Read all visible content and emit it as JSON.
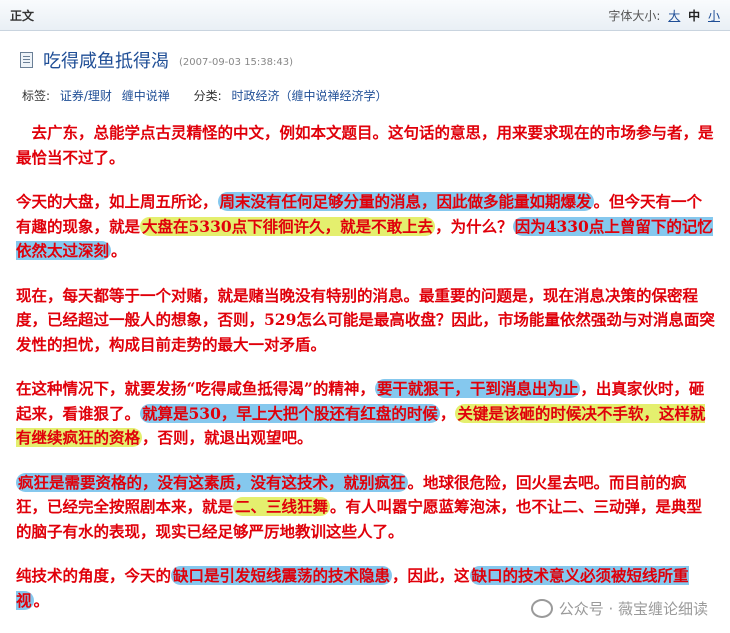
{
  "topbar": {
    "section_label": "正文",
    "fontsize_label": "字体大小:",
    "opts": [
      "大",
      "中",
      "小"
    ]
  },
  "post": {
    "title": "吃得咸鱼抵得渴",
    "date": "(2007-09-03 15:38:43)",
    "tags_label": "标签:",
    "tags": [
      "证券/理财",
      "缠中说禅"
    ],
    "category_label": "分类:",
    "category": "时政经济（缠中说禅经济学）"
  },
  "article": {
    "p1": "　去广东，总能学点古灵精怪的中文，例如本文题目。这句话的意思，用来要求现在的市场参与者，是最恰当不过了。",
    "p2": [
      "今天的大盘，如上周五所论，",
      "周末没有任何足够分量的消息，因此做多能量如期爆发",
      "。但今天有一个有趣的现象，就是",
      "大盘在5330点下徘徊许久，就是不敢上去",
      "，为什么？",
      "因为4330点上曾留下的记忆依然太过深刻",
      "。"
    ],
    "p3": "现在，每天都等于一个对赌，就是赌当晚没有特别的消息。最重要的问题是，现在消息决策的保密程度，已经超过一般人的想象，否则，529怎么可能是最高收盘？因此，市场能量依然强劲与对消息面突发性的担忧，构成目前走势的最大一对矛盾。",
    "p4": [
      "在这种情况下，就要发扬“吃得咸鱼抵得渴”的精神，",
      "要干就狠干，干到消息出为止",
      "，出真家伙时，砸起来，看谁狠了。",
      "就算是530，早上大把个股还有红盘的时候",
      "，",
      "关键是该砸的时候决不手软，这样就有继续疯狂的资格",
      "，否则，就退出观望吧。"
    ],
    "p5": [
      "疯狂是需要资格的，没有这素质，没有这技术，就别疯狂",
      "。地球很危险，回火星去吧。而目前的疯狂，已经完全按照剧本来，就是",
      "二、三线狂舞",
      "。有人叫嚣宁愿蓝筹泡沫，也不让二、三动弹，是典型的脑子有水的表现，现实已经足够严厉地教训这些人了。"
    ],
    "p6": [
      "纯技术的角度，今天的",
      "缺口是引发短线震荡的技术隐患",
      "，因此，这",
      "缺口的技术意义必须被短线所重视",
      "。"
    ]
  },
  "watermark": "公众号 · 薇宝缠论细读",
  "colors": {
    "text": "#e0000a",
    "highlight_blue": "#85c8ee",
    "highlight_yellow": "#e4ef6e",
    "link": "#1f4e96"
  }
}
